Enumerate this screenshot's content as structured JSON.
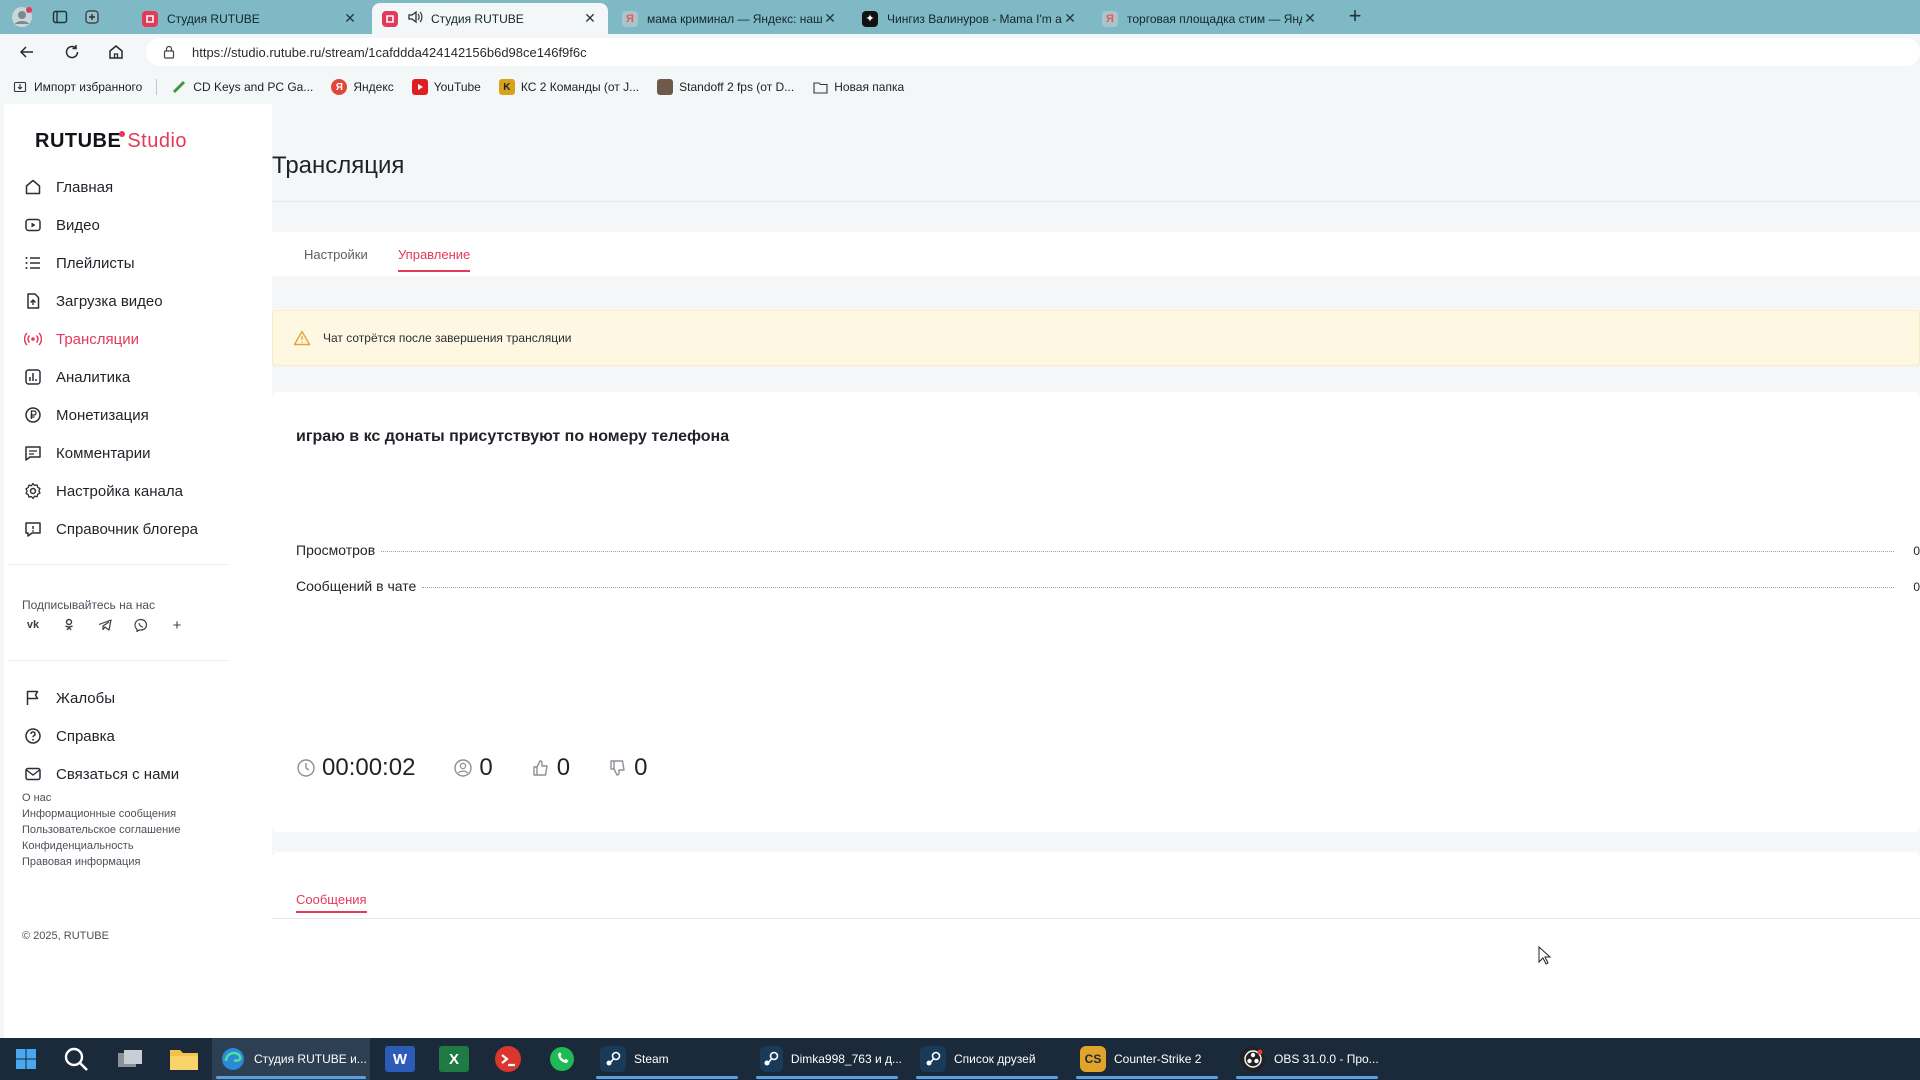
{
  "browser": {
    "tabs": [
      {
        "title": "Студия RUTUBE",
        "active": false
      },
      {
        "title": "Студия RUTUBE",
        "active": true
      },
      {
        "title": "мама криминал — Яндекс: наш",
        "active": false
      },
      {
        "title": "Чингиз Валинуров - Mama I'm a",
        "active": false
      },
      {
        "title": "торговая площадка стим — Янд",
        "active": false
      }
    ],
    "url": "https://studio.rutube.ru/stream/1cafddda424142156b6d98ce146f9f6c",
    "bookmarks": [
      "Импорт избранного",
      "CD Keys and PC Ga...",
      "Яндекс",
      "YouTube",
      "КС 2 Команды (от J...",
      "Standoff 2 fps (от D...",
      "Новая папка"
    ]
  },
  "sidebar": {
    "logo_main": "RUTUBE",
    "logo_studio": "Studio",
    "items": [
      {
        "label": "Главная",
        "icon": "home-icon"
      },
      {
        "label": "Видео",
        "icon": "video-icon"
      },
      {
        "label": "Плейлисты",
        "icon": "playlist-icon"
      },
      {
        "label": "Загрузка видео",
        "icon": "upload-icon"
      },
      {
        "label": "Трансляции",
        "icon": "broadcast-icon",
        "active": true
      },
      {
        "label": "Аналитика",
        "icon": "analytics-icon"
      },
      {
        "label": "Монетизация",
        "icon": "monetization-icon"
      },
      {
        "label": "Комментарии",
        "icon": "comments-icon"
      },
      {
        "label": "Настройка канала",
        "icon": "gear-icon"
      },
      {
        "label": "Справочник блогера",
        "icon": "help-book-icon"
      }
    ],
    "subscribe_label": "Подписывайтесь на нас",
    "socials": [
      "vk-icon",
      "ok-icon",
      "telegram-icon",
      "viber-icon",
      "plus-icon"
    ],
    "secondary_items": [
      {
        "label": "Жалобы",
        "icon": "flag-icon"
      },
      {
        "label": "Справка",
        "icon": "question-icon"
      },
      {
        "label": "Связаться с нами",
        "icon": "mail-icon"
      }
    ],
    "footer_links": [
      "О нас",
      "Информационные сообщения",
      "Пользовательское соглашение",
      "Конфиденциальность",
      "Правовая информация"
    ],
    "copyright": "© 2025, RUTUBE"
  },
  "main": {
    "title": "Трансляция",
    "tabs": [
      {
        "label": "Настройки",
        "active": false
      },
      {
        "label": "Управление",
        "active": true
      }
    ],
    "warning": "Чат сотрётся после завершения трансляции",
    "stream_title": "играю в кс донаты присутствуют по номеру телефона",
    "stats": [
      {
        "label": "Просмотров",
        "value": "0"
      },
      {
        "label": "Сообщений в чате",
        "value": "0"
      }
    ],
    "metrics": {
      "duration": "00:00:02",
      "viewers": "0",
      "likes": "0",
      "dislikes": "0"
    },
    "chat_tab": "Сообщения"
  },
  "taskbar": {
    "apps": [
      {
        "label": "Студия RUTUBE и...",
        "active": true
      },
      {
        "label": "Steam"
      },
      {
        "label": "Dimka998_763 и д..."
      },
      {
        "label": "Список друзей"
      },
      {
        "label": "Counter-Strike 2"
      },
      {
        "label": "OBS 31.0.0 - Про..."
      }
    ]
  },
  "colors": {
    "accent": "#e5395a",
    "tabbar": "#7fb9c6",
    "warning_bg": "#fef7e2",
    "taskbar": "#1b2a3a"
  }
}
